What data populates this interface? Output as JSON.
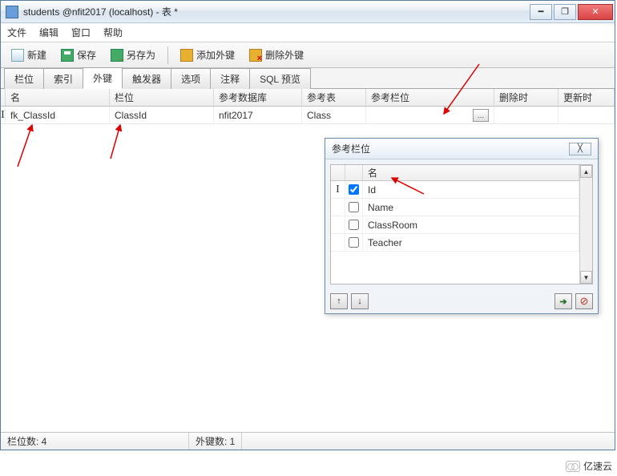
{
  "window": {
    "title": "students @nfit2017 (localhost) - 表 *"
  },
  "menubar": {
    "file": "文件",
    "edit": "编辑",
    "window": "窗口",
    "help": "帮助"
  },
  "toolbar": {
    "new": "新建",
    "save": "保存",
    "saveas": "另存为",
    "addfk": "添加外键",
    "delfk": "删除外键"
  },
  "tabs": {
    "fields": "栏位",
    "indexes": "索引",
    "fkeys": "外键",
    "triggers": "触发器",
    "options": "选项",
    "comments": "注释",
    "sqlpreview": "SQL 预览"
  },
  "grid": {
    "headers": {
      "name": "名",
      "column": "栏位",
      "refdb": "参考数据库",
      "reftbl": "参考表",
      "refcol": "参考栏位",
      "ondelete": "删除时",
      "onupdate": "更新时"
    },
    "row": {
      "name": "fk_ClassId",
      "column": "ClassId",
      "refdb": "nfit2017",
      "reftbl": "Class",
      "refcol": "",
      "ellipsis": "…"
    }
  },
  "popup": {
    "title": "参考栏位",
    "header_name": "名",
    "items": [
      {
        "label": "Id",
        "checked": true,
        "cursor": true
      },
      {
        "label": "Name",
        "checked": false,
        "cursor": false
      },
      {
        "label": "ClassRoom",
        "checked": false,
        "cursor": false
      },
      {
        "label": "Teacher",
        "checked": false,
        "cursor": false
      }
    ],
    "close_glyph": "╳",
    "up_glyph": "↑",
    "down_glyph": "↓",
    "ok_glyph": "➔",
    "cancel_glyph": "⊘"
  },
  "statusbar": {
    "fields": "栏位数: 4",
    "fkcount": "外键数: 1"
  },
  "watermark": "亿速云"
}
